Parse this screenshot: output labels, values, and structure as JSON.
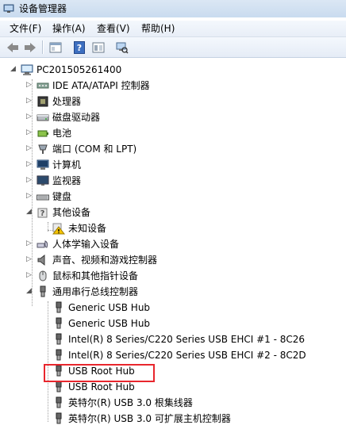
{
  "window": {
    "title": "设备管理器"
  },
  "menu": [
    "文件(F)",
    "操作(A)",
    "查看(V)",
    "帮助(H)"
  ],
  "toolbar": [
    "back-icon",
    "forward-icon",
    "properties-icon",
    "help-icon",
    "view-icon",
    "scan-hardware-icon"
  ],
  "tree": {
    "root": "PC201505261400",
    "categories": [
      "IDE ATA/ATAPI 控制器",
      "处理器",
      "磁盘驱动器",
      "电池",
      "端口 (COM 和 LPT)",
      "计算机",
      "监视器",
      "键盘",
      "其他设备",
      "人体学输入设备",
      "声音、视频和游戏控制器",
      "鼠标和其他指针设备",
      "通用串行总线控制器"
    ],
    "other_devices": [
      "未知设备"
    ],
    "usb_devices": [
      "Generic USB Hub",
      "Generic USB Hub",
      "Intel(R) 8 Series/C220 Series USB EHCI #1 - 8C26",
      "Intel(R) 8 Series/C220 Series USB EHCI #2 - 8C2D",
      "USB Root Hub",
      "USB Root Hub",
      "英特尔(R) USB 3.0 根集线器",
      "英特尔(R) USB 3.0 可扩展主机控制器"
    ]
  },
  "highlighted_item": "USB Root Hub",
  "colors": {
    "highlight": "#e8262d",
    "titlebar": "#c9dbef"
  }
}
